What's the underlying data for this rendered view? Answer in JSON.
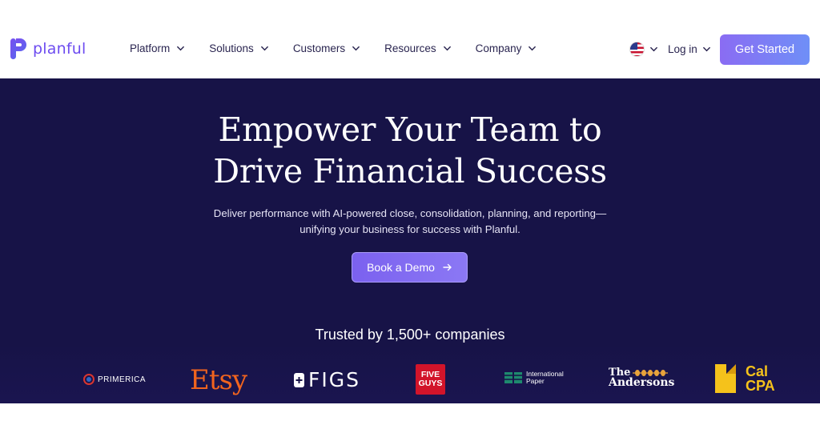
{
  "brand": {
    "name": "planful"
  },
  "nav": {
    "items": [
      {
        "label": "Platform"
      },
      {
        "label": "Solutions"
      },
      {
        "label": "Customers"
      },
      {
        "label": "Resources"
      },
      {
        "label": "Company"
      }
    ],
    "login_label": "Log in",
    "cta_label": "Get Started"
  },
  "hero": {
    "headline_line1": "Empower Your Team to",
    "headline_line2": "Drive Financial Success",
    "subtext_line1": "Deliver performance with AI-powered close, consolidation, planning, and reporting—",
    "subtext_line2": "unifying your business for success with Planful.",
    "demo_label": "Book a Demo",
    "trusted_label": "Trusted by 1,500+ companies"
  },
  "logos": {
    "primerica": "PRIMERICA",
    "etsy": "Etsy",
    "figs": "FIGS",
    "five_guys_1": "FIVE",
    "five_guys_2": "GUYS",
    "international_paper_1": "International",
    "international_paper_2": "Paper",
    "andersons_1": "The",
    "andersons_2": "Andersons",
    "calcpa_1": "Cal",
    "calcpa_2": "CPA"
  },
  "colors": {
    "hero_bg": "#171347",
    "brand_purple": "#6d4cf0",
    "button_gradient_start": "#8a6cf3",
    "button_gradient_end": "#6f8ff7"
  },
  "icons": {
    "chevron": "chevron-down-icon",
    "arrow": "arrow-right-icon",
    "flag": "us-flag-icon"
  }
}
